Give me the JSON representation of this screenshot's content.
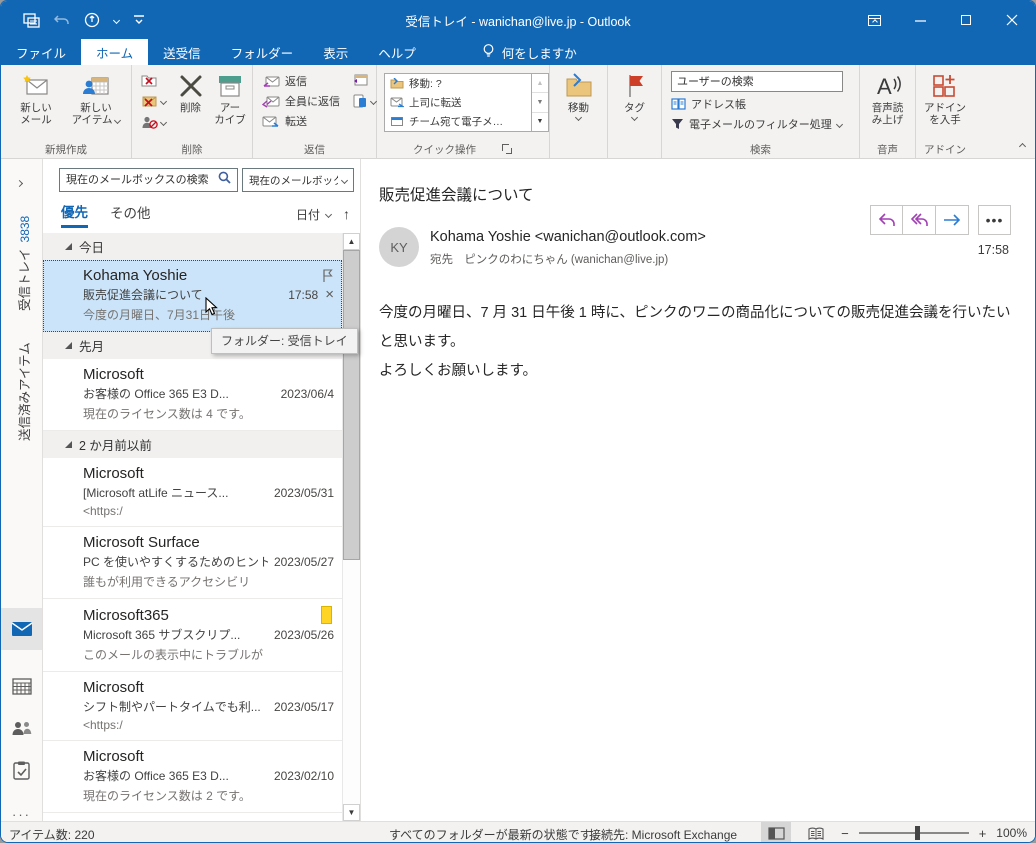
{
  "titlebar": {
    "title": "受信トレイ - wanichan@live.jp -  Outlook"
  },
  "tabs": {
    "file": "ファイル",
    "home": "ホーム",
    "sendreceive": "送受信",
    "folder": "フォルダー",
    "view": "表示",
    "help": "ヘルプ",
    "tellme": "何をしますか"
  },
  "ribbon": {
    "new_group_label": "新規作成",
    "new_mail": "新しい\nメール",
    "new_items": "新しい\nアイテム",
    "delete_group_label": "削除",
    "delete_label": "削除",
    "archive_label": "アー\nカイブ",
    "reply_group_label": "返信",
    "reply": "返信",
    "reply_all": "全員に返信",
    "forward": "転送",
    "quick_group_label": "クイック操作",
    "quick_steps": [
      "移動: ?",
      "上司に転送",
      "チーム宛て電子メ…"
    ],
    "move_label": "移動",
    "tags_label": "タグ",
    "search_group_label": "検索",
    "find_user_placeholder": "ユーザーの検索",
    "address_book": "アドレス帳",
    "filter_email": "電子メールのフィルター処理",
    "speech_group_label": "音声",
    "read_aloud": "音声読\nみ上げ",
    "addins_group_label": "アドイン",
    "get_addins": "アドイン\nを入手"
  },
  "nav": {
    "inbox": "受信トレイ",
    "inbox_count": "3838",
    "sent": "送信済みアイテム"
  },
  "maillist": {
    "search_placeholder": "現在のメールボックスの検索",
    "scope": "現在のメールボックス",
    "tab_focused": "優先",
    "tab_other": "その他",
    "sort": "日付",
    "tooltip": "フォルダー: 受信トレイ",
    "groups": [
      {
        "label": "今日",
        "items": [
          {
            "sender": "Kohama Yoshie",
            "subject": "販売促進会議について",
            "time": "17:58",
            "preview": "今度の月曜日、7月31日午後",
            "selected": true,
            "flag": true,
            "close": true
          }
        ]
      },
      {
        "label": "先月",
        "items": [
          {
            "sender": "Microsoft",
            "subject": "お客様の Office 365 E3 D...",
            "date": "2023/06/4",
            "preview": "現在のライセンス数は 4 です。"
          }
        ]
      },
      {
        "label": "2 か月前以前",
        "items": [
          {
            "sender": "Microsoft",
            "subject": "[Microsoft atLife ニュース...",
            "date": "2023/05/31",
            "preview": "<https:/"
          },
          {
            "sender": "Microsoft Surface",
            "subject": "PC を使いやすくするためのヒント",
            "date": "2023/05/27",
            "preview": "誰もが利用できるアクセシビリ"
          },
          {
            "sender": "Microsoft365",
            "subject": "Microsoft 365 サブスクリプ...",
            "date": "2023/05/26",
            "preview": "このメールの表示中にトラブルが",
            "category": true
          },
          {
            "sender": "Microsoft",
            "subject": "シフト制やパートタイムでも利...",
            "date": "2023/05/17",
            "preview": "<https:/"
          },
          {
            "sender": "Microsoft",
            "subject": "お客様の Office 365 E3 D...",
            "date": "2023/02/10",
            "preview": "現在のライセンス数は 2 です。"
          }
        ]
      }
    ]
  },
  "message": {
    "subject": "販売促進会議について",
    "avatar": "KY",
    "from": "Kohama Yoshie <wanichan@outlook.com>",
    "to_label": "宛先",
    "to": "ピンクのわにちゃん (wanichan@live.jp)",
    "time": "17:58",
    "body": [
      "今度の月曜日、7 月 31 日午後 1 時に、ピンクのワニの商品化についての販売促進会議を行いたい",
      "と思います。",
      "よろしくお願いします。"
    ]
  },
  "statusbar": {
    "items_count": "アイテム数: 220",
    "folders_status": "すべてのフォルダーが最新の状態です。",
    "connection": "接続先: Microsoft Exchange",
    "zoom": "100%",
    "zoom_out": "−",
    "zoom_in": "+"
  },
  "colors": {
    "accent": "#1267B5",
    "selection": "#CBE4F9",
    "flag_red": "#CE3F2A",
    "folder_tan": "#ECC57C"
  }
}
